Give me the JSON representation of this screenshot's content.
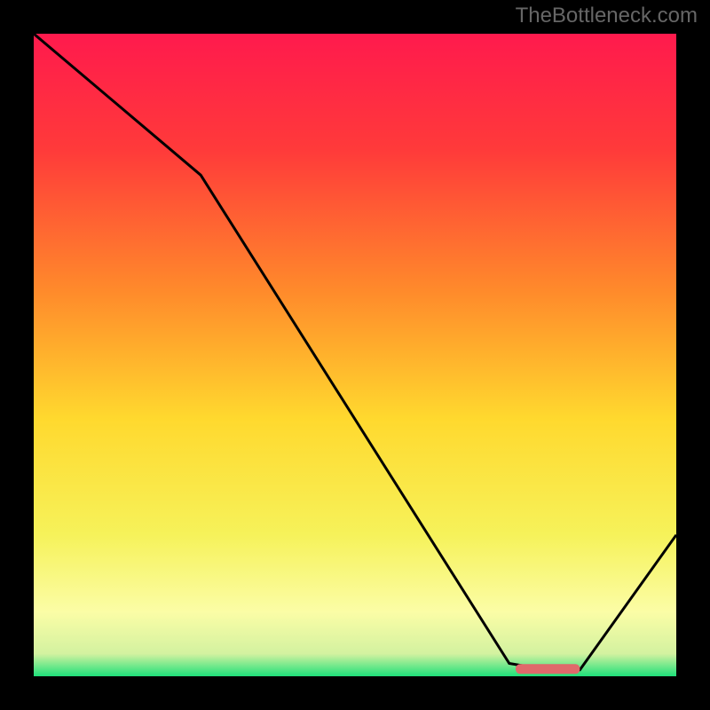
{
  "watermark": "TheBottleneck.com",
  "chart_data": {
    "type": "line",
    "title": "",
    "xlabel": "",
    "ylabel": "",
    "xlim": [
      0,
      100
    ],
    "ylim": [
      0,
      100
    ],
    "background": {
      "type": "vertical_gradient",
      "stops": [
        {
          "offset": 0.0,
          "color": "#ff1a4d"
        },
        {
          "offset": 0.18,
          "color": "#ff3a3a"
        },
        {
          "offset": 0.4,
          "color": "#ff8a2b"
        },
        {
          "offset": 0.6,
          "color": "#ffd92e"
        },
        {
          "offset": 0.78,
          "color": "#f6f25a"
        },
        {
          "offset": 0.9,
          "color": "#fbfda6"
        },
        {
          "offset": 0.965,
          "color": "#d3f2a0"
        },
        {
          "offset": 1.0,
          "color": "#1ee07a"
        }
      ]
    },
    "series": [
      {
        "name": "bottleneck_curve",
        "x": [
          0,
          26,
          74,
          80,
          85,
          100
        ],
        "y": [
          100,
          78,
          2,
          1,
          1,
          22
        ]
      }
    ],
    "optimal_marker": {
      "x_start": 75,
      "x_end": 85,
      "y": 1.2,
      "color": "#e0696b"
    }
  }
}
